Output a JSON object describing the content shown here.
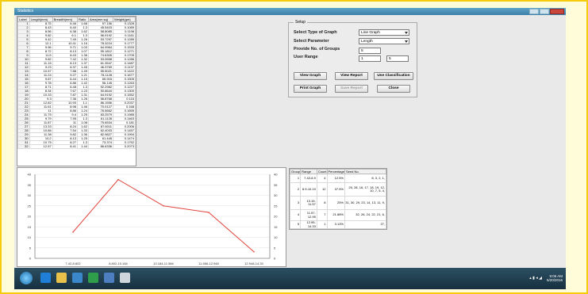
{
  "window": {
    "title": "Statistics"
  },
  "grid": {
    "columns": [
      "Label",
      "Length(mm)",
      "Breadth(mm)",
      "Ratio",
      "Area(mm sq)",
      "Weight(gm)"
    ],
    "rows": [
      [
        "1",
        "8.75",
        "6.46",
        "1.66",
        "57.156",
        "0.1328"
      ],
      [
        "2",
        "8.43",
        "6.40",
        "1.3",
        "45.5403",
        "0.1089"
      ],
      [
        "3",
        "8.56",
        "6.38",
        "1.62",
        "58.8085",
        "0.1198"
      ],
      [
        "4",
        "9.82",
        "6.1",
        "1.3",
        "56.9192",
        "0.1161"
      ],
      [
        "5",
        "9.42",
        "7.49",
        "1.26",
        "53.7297",
        "0.1285"
      ],
      [
        "6",
        "12.1",
        "10.41",
        "1.16",
        "78.3224",
        "0.1777"
      ],
      [
        "7",
        "9.96",
        "9.71",
        "1.03",
        "64.9964",
        "0.1533"
      ],
      [
        "8",
        "8.72",
        "8.13",
        "1.07",
        "55.1812",
        "0.1271"
      ],
      [
        "9",
        "11.5",
        "8.43",
        "1.36",
        "74.6305",
        "0.1705"
      ],
      [
        "10",
        "9.82",
        "7.42",
        "1.32",
        "53.0558",
        "0.1286"
      ],
      [
        "11",
        "11.15",
        "8.13",
        "1.37",
        "61.3547",
        "0.1487"
      ],
      [
        "12",
        "9.23",
        "6.37",
        "1.45",
        "46.3769",
        "0.1137"
      ],
      [
        "13",
        "10.57",
        "7.88",
        "1.49",
        "55.5021",
        "0.1422"
      ],
      [
        "14",
        "11.24",
        "9.27",
        "1.21",
        "78.1128",
        "0.1677"
      ],
      [
        "15",
        "9.67",
        "6.44",
        "1.15",
        "65.916",
        "0.1505"
      ],
      [
        "16",
        "9.78",
        "6.86",
        "1.42",
        "56.145",
        "0.1263"
      ],
      [
        "17",
        "8.71",
        "6.48",
        "1.3",
        "52.2982",
        "0.1227"
      ],
      [
        "18",
        "8.34",
        "7.67",
        "1.23",
        "50.8644",
        "0.1300"
      ],
      [
        "19",
        "10.33",
        "7.87",
        "1.31",
        "64.9192",
        "0.1552"
      ],
      [
        "20",
        "9.3",
        "7.36",
        "1.26",
        "56.8768",
        "0.116"
      ],
      [
        "21",
        "12.82",
        "10.93",
        "1.1",
        "86.1556",
        "0.2037"
      ],
      [
        "22",
        "11.61",
        "8.98",
        "1.46",
        "70.0127",
        "0.168"
      ],
      [
        "23",
        "11",
        "8.86",
        "1.24",
        "76.5662",
        "0.1655"
      ],
      [
        "24",
        "11.75",
        "9.4",
        "1.25",
        "83.2579",
        "0.1985"
      ],
      [
        "25",
        "9.79",
        "7.95",
        "1.3",
        "61.1128",
        "0.1463"
      ],
      [
        "26",
        "11.87",
        "11",
        "1.08",
        "75.6534",
        "0.181"
      ],
      [
        "27",
        "13.33",
        "8.24",
        "1.62",
        "87.6011",
        "0.2006"
      ],
      [
        "28",
        "10.86",
        "7.54",
        "1.33",
        "62.4033",
        "0.1457"
      ],
      [
        "29",
        "11.38",
        "9.82",
        "1.36",
        "82.9827",
        "0.1994"
      ],
      [
        "30",
        "10.2",
        "8.13",
        "1.25",
        "61.445",
        "0.1474"
      ],
      [
        "31",
        "10.75",
        "8.27",
        "1.3",
        "73.374",
        "0.1752"
      ],
      [
        "32",
        "12.57",
        "8.41",
        "1.44",
        "86.6336",
        "0.2073"
      ]
    ]
  },
  "setup": {
    "title": "Setup",
    "graph_type_label": "Select Type of Graph",
    "graph_type_value": "Line Graph",
    "parameter_label": "Select Parameter",
    "parameter_value": "Length",
    "groups_label": "Provide  No. of Groups",
    "groups_value": "5",
    "range_label": "User Range",
    "range_from": "1",
    "range_to": "5",
    "buttons": {
      "view_graph": "View Graph",
      "view_report": "View Report",
      "use_classification": "Use Classification",
      "print_graph": "Print Graph",
      "save_report": "Save Report",
      "close": "Close"
    }
  },
  "group_table": {
    "columns": [
      "Group",
      "Range",
      "Count",
      "Percentage",
      "Seed No."
    ],
    "rows": [
      [
        "1",
        "7.42-8.9",
        "4",
        "12.5%",
        "8, 3, 2, 1,"
      ],
      [
        "2",
        "8.9-10.19",
        "12",
        "37.5%",
        "25, 28, 16, 17, 18, 19, 12, 10, 7, 5, 4,"
      ],
      [
        "3",
        "10.19-11.57",
        "8",
        "25%",
        "31, 30, 29, 23, 14, 13, 11, 9,"
      ],
      [
        "4",
        "11.57-12.95",
        "7",
        "21.88%",
        "32, 26, 24, 22, 21, 6,"
      ],
      [
        "5",
        "12.95-14.33",
        "1",
        "3.13%",
        "27,"
      ]
    ]
  },
  "chart_data": {
    "type": "line",
    "categories": [
      "7.42-8.802",
      "8.802-10.184",
      "10.184-11.566",
      "11.566-12.948",
      "12.948-14.33"
    ],
    "values": [
      12.5,
      37.5,
      25,
      21.88,
      3.13
    ],
    "ylim": [
      0,
      40
    ],
    "yticks": [
      0,
      5,
      10,
      15,
      20,
      25,
      30,
      35,
      40
    ],
    "title": "",
    "xlabel": "",
    "ylabel": "",
    "line_color": "#e0443c",
    "grid": true
  },
  "taskbar": {
    "time": "9:06 AM",
    "date": "5/20/2016"
  },
  "colors": {
    "accent": "#2b6f8f",
    "line": "#e0443c"
  }
}
